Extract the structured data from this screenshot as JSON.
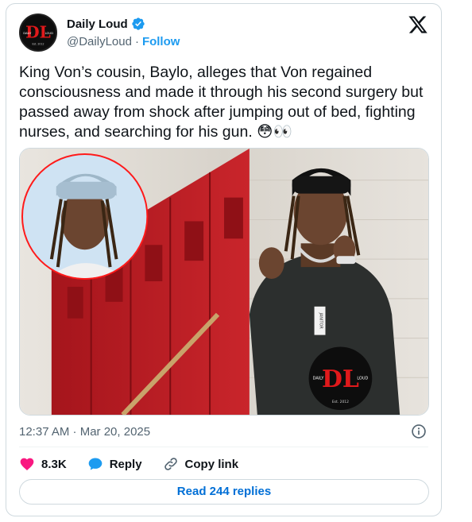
{
  "account": {
    "display_name": "Daily Loud",
    "handle": "@DailyLoud",
    "separator": "·",
    "follow_label": "Follow",
    "avatar_logo_text": "DL",
    "avatar_small_left": "DAILY",
    "avatar_small_right": "LOUD",
    "avatar_est": "Est. 2012"
  },
  "tweet": {
    "text": "King Von’s cousin, Baylo, alleges that Von regained consciousness and made it through his second surgery but passed away from shock after jumping out of bed, fighting nurses, and searching for his gun. 😳👀",
    "timestamp": "12:37 AM · Mar 20, 2025"
  },
  "media": {
    "watermark_logo_text": "DL",
    "watermark_left": "DAILY",
    "watermark_right": "LOUD",
    "watermark_est": "Est. 2012",
    "badge_text": "JANITOR"
  },
  "actions": {
    "likes_count": "8.3K",
    "reply_label": "Reply",
    "copy_link_label": "Copy link"
  },
  "footer": {
    "read_replies_label": "Read 244 replies"
  },
  "colors": {
    "like_red": "#f91880",
    "reply_blue": "#1d9bf0",
    "link_blue": "#006fd6",
    "muted": "#536471",
    "brand_red": "#e0191b"
  },
  "icons": {
    "verified": "verified-badge-icon",
    "x_logo": "x-logo-icon",
    "info": "info-icon",
    "like": "heart-icon",
    "reply": "speech-bubble-icon",
    "copy_link": "link-icon"
  }
}
